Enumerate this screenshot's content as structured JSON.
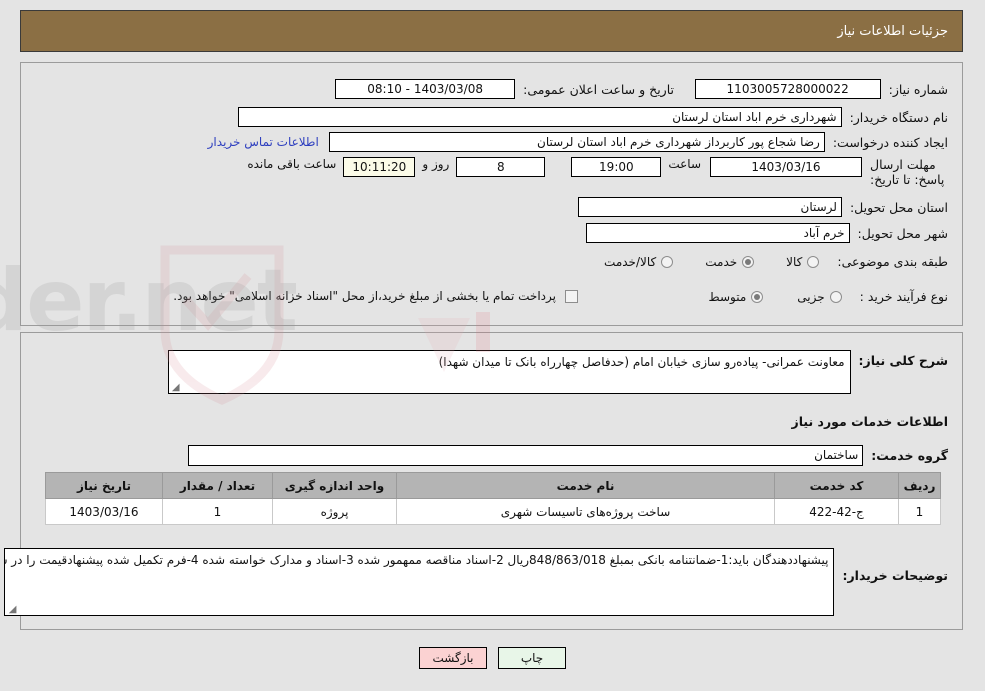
{
  "header": {
    "title": "جزئیات اطلاعات نیاز"
  },
  "summary": {
    "need_number_label": "شماره نیاز:",
    "need_number_value": "1103005728000022",
    "announce_datetime_label": "تاریخ و ساعت اعلان عمومی:",
    "announce_datetime_value": "1403/03/08 - 08:10",
    "buyer_org_label": "نام دستگاه خریدار:",
    "buyer_org_value": "شهرداری خرم اباد استان لرستان",
    "requester_label": "ایجاد کننده درخواست:",
    "requester_value": "رضا شجاع پور کاربرداز شهرداری خرم اباد استان لرستان",
    "contact_link": "اطلاعات تماس خریدار",
    "deadline_label": "مهلت ارسال پاسخ: تا تاریخ:",
    "deadline_date": "1403/03/16",
    "time_label": "ساعت",
    "deadline_time": "19:00",
    "days_remaining": "8",
    "days_label": "روز و",
    "countdown": "10:11:20",
    "countdown_label": "ساعت باقی مانده",
    "province_label": "استان محل تحویل:",
    "province_value": "لرستان",
    "city_label": "شهر محل تحویل:",
    "city_value": "خرم آباد",
    "category_label": "طبقه بندی موضوعی:",
    "category_options": [
      {
        "label": "کالا",
        "selected": false
      },
      {
        "label": "خدمت",
        "selected": true
      },
      {
        "label": "کالا/خدمت",
        "selected": false
      }
    ],
    "process_label": "نوع فرآیند خرید :",
    "process_options": [
      {
        "label": "جزیی",
        "selected": false
      },
      {
        "label": "متوسط",
        "selected": true
      }
    ],
    "treasury_checkbox_checked": false,
    "treasury_note": "پرداخت تمام یا بخشی از مبلغ خرید،از محل \"اسناد خزانه اسلامی\" خواهد بود."
  },
  "need": {
    "description_label": "شرح کلی نیاز:",
    "description_value": "معاونت عمرانی- پیاده‌رو سازی خیابان امام (حدفاصل چهارراه بانک تا میدان شهدا)",
    "services_section_title": "اطلاعات خدمات مورد نیاز",
    "service_group_label": "گروه خدمت:",
    "service_group_value": "ساختمان"
  },
  "table": {
    "columns": [
      "ردیف",
      "کد خدمت",
      "نام خدمت",
      "واحد اندازه گیری",
      "تعداد / مقدار",
      "تاریخ نیاز"
    ],
    "rows": [
      [
        "1",
        "ج-42-422",
        "ساخت پروژه‌های تاسیسات شهری",
        "پروژه",
        "1",
        "1403/03/16"
      ]
    ]
  },
  "notes": {
    "label": "توضیحات خریدار:",
    "value": "پیشنهاددهندگان باید:1-ضمانتنامه بانکی بمبلغ 848/863/018ریال 2-اسناد مناقصه ممهمور شده 3-اسناد و مدارک خواسته شده 4-فرم تکمیل شده پیشنهادقیمت را در سامانه بارگذاری نمایند"
  },
  "buttons": {
    "print": "چاپ",
    "back": "بازگشت"
  },
  "colors": {
    "header_brown": "#8b6f44",
    "page_bg": "#e4e4e4",
    "table_header": "#b4b4b4",
    "link_blue": "#2e3fbf",
    "print_btn": "#e8f6e8",
    "back_btn": "#fbd2d2"
  }
}
